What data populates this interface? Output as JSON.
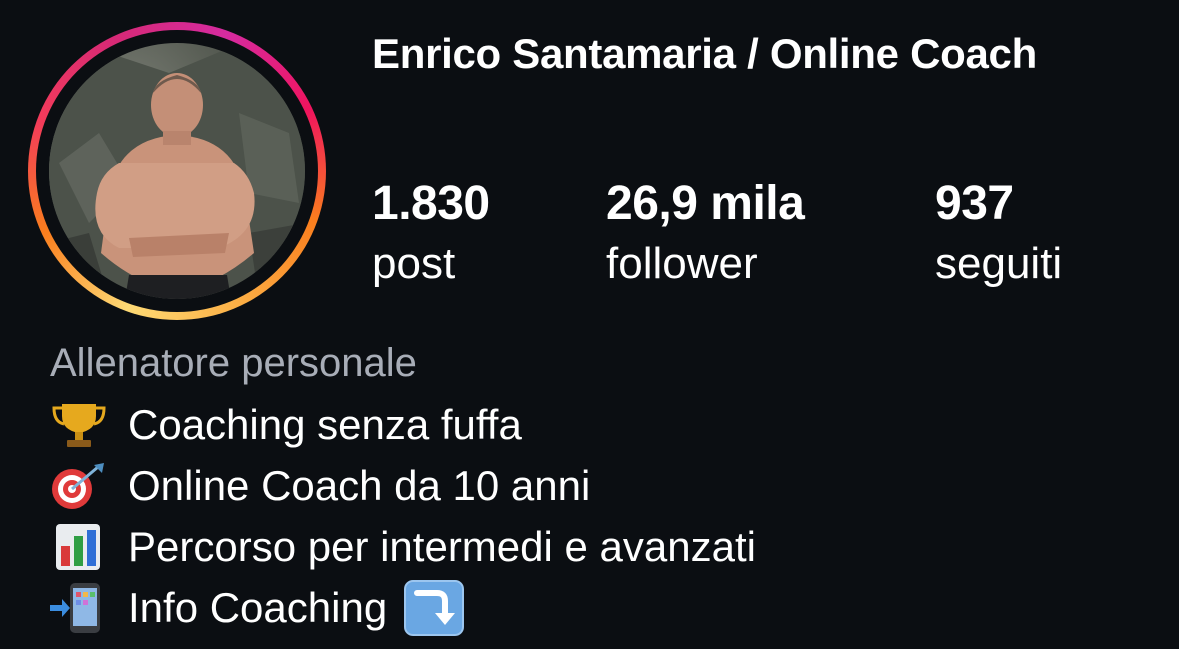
{
  "profile": {
    "name": "Enrico Santamaria / Online Coach",
    "avatar_icon": "profile-photo",
    "story_ring_colors": [
      "#feda75",
      "#fa7e1e",
      "#d62976",
      "#962fbf"
    ]
  },
  "stats": [
    {
      "value": "1.830",
      "label": "post"
    },
    {
      "value": "26,9 mila",
      "label": "follower"
    },
    {
      "value": "937",
      "label": "seguiti"
    }
  ],
  "bio": {
    "category": "Allenatore personale",
    "lines": [
      {
        "icon": "trophy-icon",
        "text": "Coaching senza fuffa"
      },
      {
        "icon": "target-icon",
        "text": "Online Coach da 10 anni"
      },
      {
        "icon": "bar-chart-icon",
        "text": "Percorso per intermedi e avanzati"
      },
      {
        "icon": "phone-arrow-icon",
        "text": "Info Coaching",
        "trailing_icon": "arrow-down-right-icon"
      }
    ]
  },
  "colors": {
    "background": "#0b0e12",
    "text": "#ffffff",
    "category_text": "#a8adb7"
  }
}
